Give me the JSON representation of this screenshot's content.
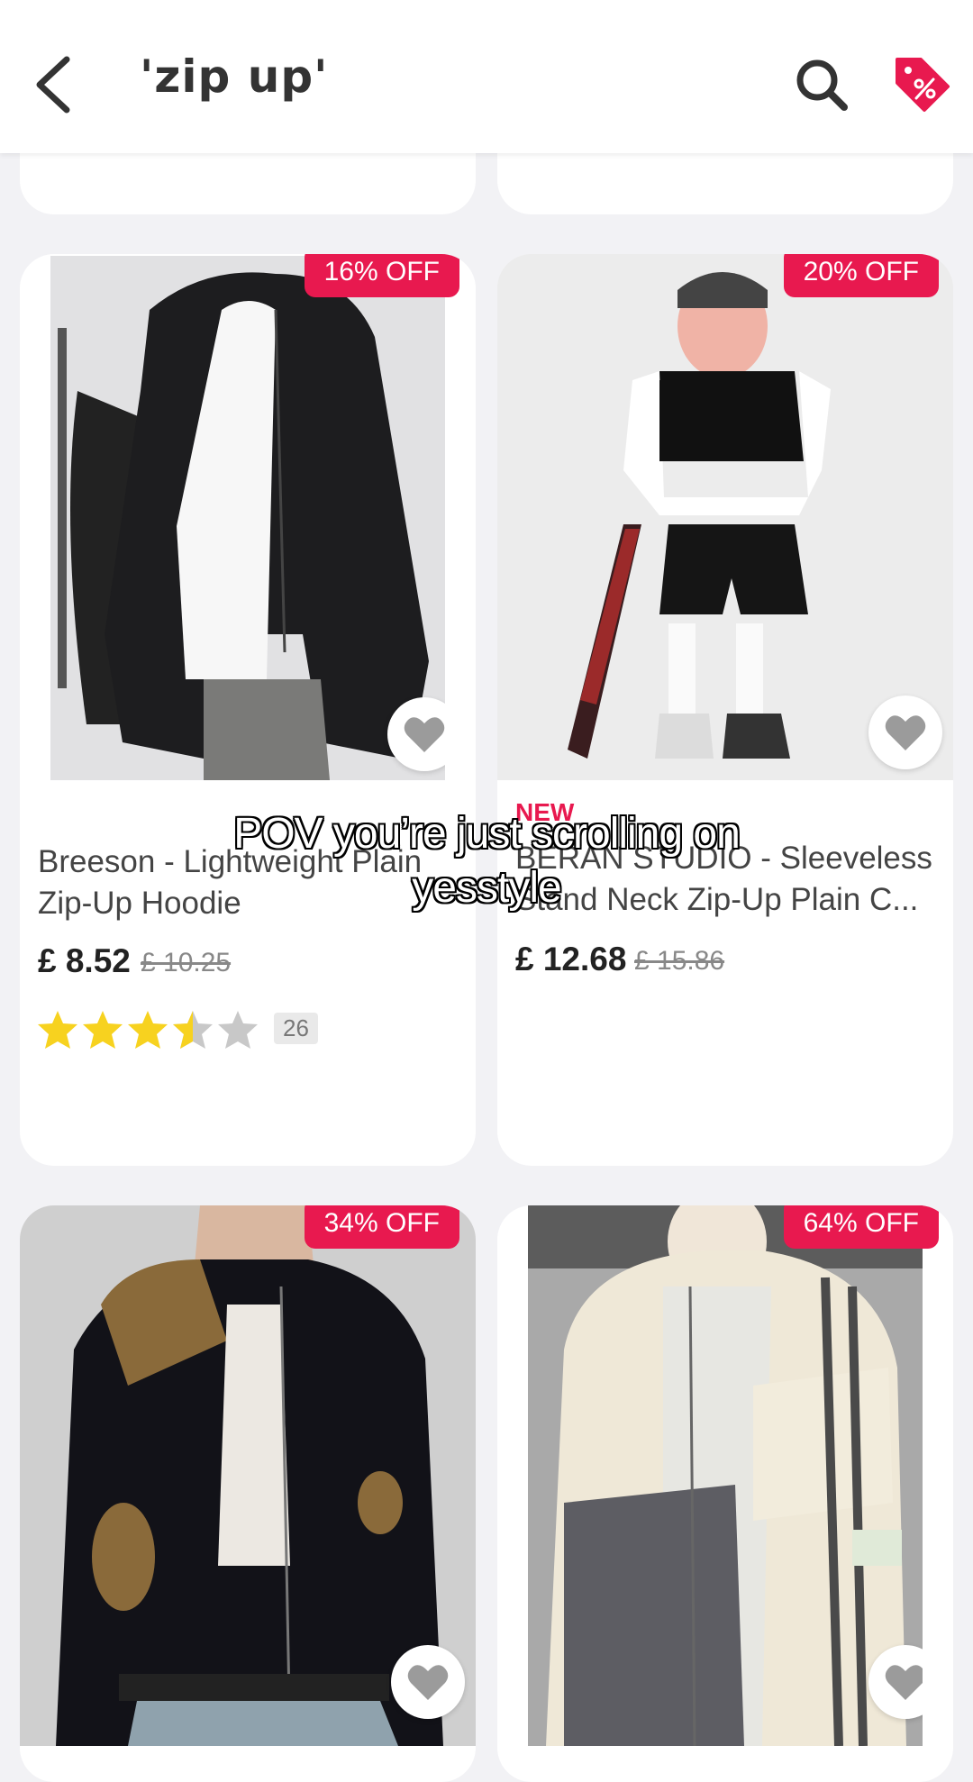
{
  "header": {
    "title": "'zip up'",
    "back_icon": "chevron-left-icon",
    "search_icon": "search-icon",
    "deals_icon": "discount-tag-icon",
    "accent_color": "#e8194f"
  },
  "products": [
    {
      "badge": "16% OFF",
      "name_line1": "Breeson - Lightweight Plain",
      "name_line2": "Zip-Up Hoodie",
      "price": "£ 8.52",
      "old_price": "£ 10.25",
      "rating": 3.5,
      "review_count": "26"
    },
    {
      "badge": "20% OFF",
      "tag": "NEW",
      "name_line1": "BERAN STUDIO - Sleeveless",
      "name_line2": "Stand Neck Zip-Up Plain C...",
      "price": "£ 12.68",
      "old_price": "£ 15.86"
    },
    {
      "badge": "34% OFF"
    },
    {
      "badge": "64% OFF"
    }
  ],
  "caption": {
    "line1": "POV you’re just scrolling on",
    "line2": "yesstyle"
  }
}
